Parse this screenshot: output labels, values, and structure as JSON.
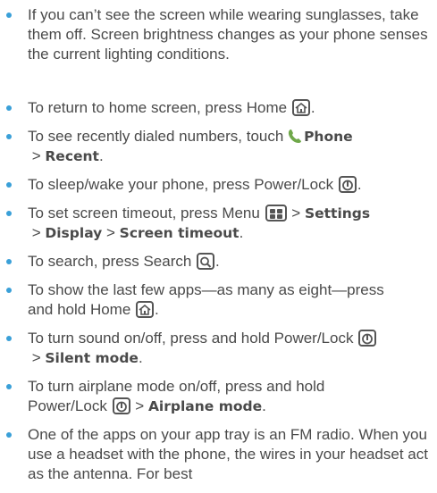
{
  "tips": [
    {
      "text1": "If you can’t see the screen while wearing sunglasses, take them off. Screen brightness changes as your phone senses the current lighting conditions."
    },
    {
      "text1": "To return to home screen, press Home",
      "key1_icon": "home-key-icon",
      "text2": "."
    },
    {
      "text1": "To see recently dialed numbers, touch",
      "phone_icon": "phone-icon",
      "b1": "Phone",
      "sep1": " > ",
      "b2": "Recent",
      "end": "."
    },
    {
      "text1": "To sleep/wake your phone, press Power/Lock",
      "key1_icon": "power-key-icon",
      "text2": "."
    },
    {
      "text1": "To set screen timeout, press Menu",
      "key1_icon": "menu-key-icon",
      "sep1": " > ",
      "b1": "Settings",
      "sep2": " > ",
      "b2": "Display",
      "sep3": " > ",
      "b3": "Screen timeout",
      "end": "."
    },
    {
      "text1": "To search, press Search",
      "key1_icon": "search-key-icon",
      "text2": "."
    },
    {
      "text1": "To show the last few apps—as many as eight—press and hold Home",
      "key1_icon": "home-key-icon",
      "text2": "."
    },
    {
      "text1": "To turn sound on/off, press and hold Power/Lock",
      "key1_icon": "power-key-icon",
      "sep1": " > ",
      "b1": "Silent mode",
      "end": "."
    },
    {
      "text1": "To turn airplane mode on/off, press and hold Power/Lock",
      "key1_icon": "power-key-icon",
      "sep1": " > ",
      "b1": "Airplane mode",
      "end": "."
    },
    {
      "text1": "One of the apps on your app tray is an FM radio. When you use a headset with the phone, the wires in your headset act as the antenna. For best"
    }
  ],
  "colors": {
    "bullet": "#3aa0d8",
    "text": "#4a4a4a",
    "phone_icon": "#6fa84a"
  }
}
